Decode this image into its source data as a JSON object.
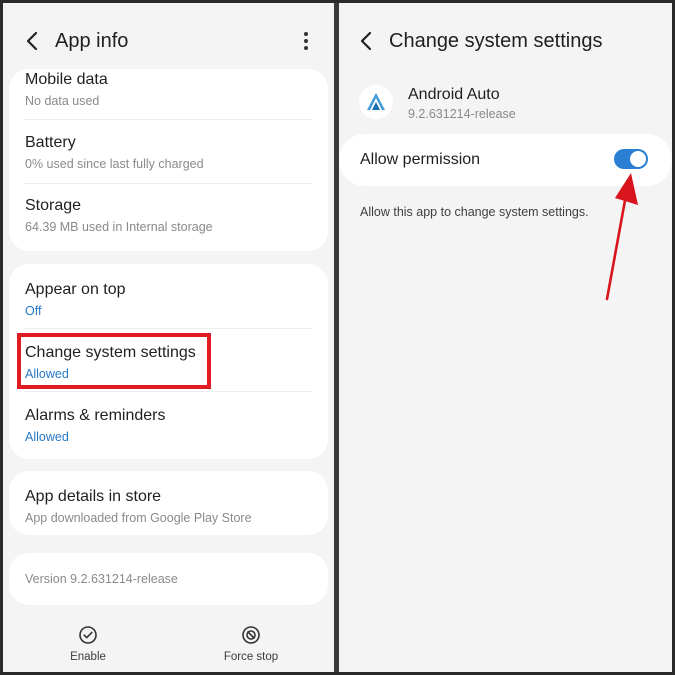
{
  "left": {
    "header": {
      "title": "App info"
    },
    "card1": [
      {
        "title": "Mobile data",
        "subtitle": "No data used"
      },
      {
        "title": "Battery",
        "subtitle": "0% used since last fully charged"
      },
      {
        "title": "Storage",
        "subtitle": "64.39 MB used in Internal storage"
      }
    ],
    "card2": [
      {
        "title": "Appear on top",
        "subtitle": "Off"
      },
      {
        "title": "Change system settings",
        "subtitle": "Allowed"
      },
      {
        "title": "Alarms & reminders",
        "subtitle": "Allowed"
      }
    ],
    "card3": {
      "title": "App details in store",
      "subtitle": "App downloaded from Google Play Store"
    },
    "version": "Version 9.2.631214-release",
    "bottom": {
      "enable_label": "Enable",
      "force_stop_label": "Force stop"
    }
  },
  "right": {
    "header": {
      "title": "Change system settings"
    },
    "app": {
      "name": "Android Auto",
      "version": "9.2.631214-release"
    },
    "permission": {
      "label": "Allow permission",
      "enabled": true
    },
    "description": "Allow this app to change system settings."
  },
  "colors": {
    "accent_blue": "#2a7fd4",
    "highlight_red": "#e11b22",
    "background": "#f4f4f4"
  }
}
